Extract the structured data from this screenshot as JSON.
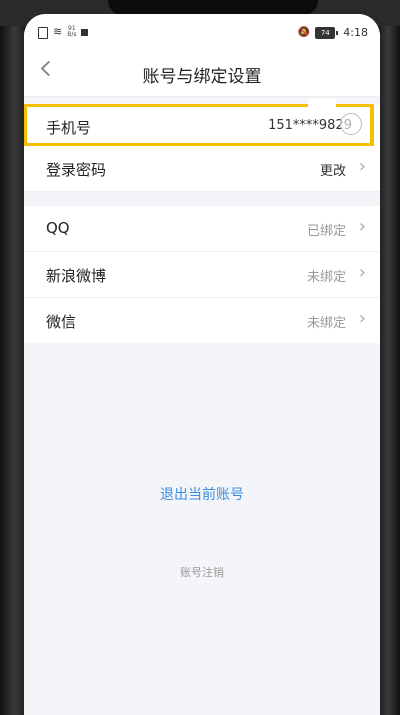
{
  "status_bar": {
    "signal_rate": "91",
    "signal_unit": "B/s",
    "battery": "74",
    "time": "4:18"
  },
  "header": {
    "back_symbol": "<",
    "title": "账号与绑定设置"
  },
  "account_rows": [
    {
      "label": "手机号",
      "value": "151****9829"
    },
    {
      "label": "登录密码",
      "value": "更改"
    }
  ],
  "binding_rows": [
    {
      "label": "QQ",
      "value": "已绑定"
    },
    {
      "label": "新浪微博",
      "value": "未绑定"
    },
    {
      "label": "微信",
      "value": "未绑定"
    }
  ],
  "actions": {
    "logout": "退出当前账号",
    "cancel_account": "账号注销"
  },
  "colors": {
    "accent_link": "#3a8ee0",
    "highlight_border": "#f4c000"
  },
  "icons": {
    "back": "chevron-left-icon",
    "row_arrow": "chevron-right-icon"
  }
}
